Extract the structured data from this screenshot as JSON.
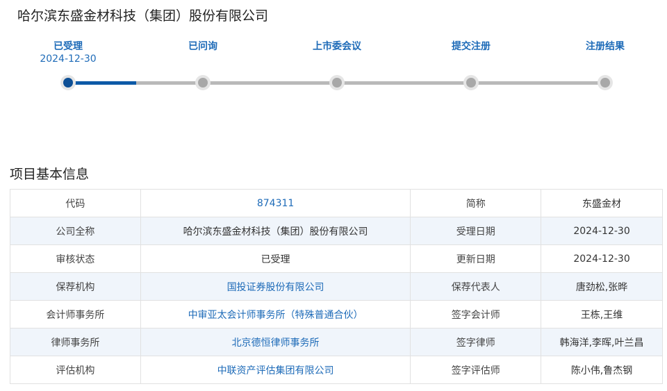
{
  "company": {
    "title": "哈尔滨东盛金材科技（集团）股份有限公司"
  },
  "progress": {
    "steps": [
      {
        "label": "已受理",
        "date": "2024-12-30",
        "active": true
      },
      {
        "label": "已问询",
        "date": "",
        "active": false
      },
      {
        "label": "上市委会议",
        "date": "",
        "active": false
      },
      {
        "label": "提交注册",
        "date": "",
        "active": false
      },
      {
        "label": "注册结果",
        "date": "",
        "active": false
      }
    ],
    "completed_fraction": 0.125
  },
  "section": {
    "title": "项目基本信息"
  },
  "info_table": {
    "rows": [
      {
        "label1": "代码",
        "value1": "874311",
        "label2": "简称",
        "value2": "东盛金材"
      },
      {
        "label1": "公司全称",
        "value1": "哈尔滨东盛金材科技（集团）股份有限公司",
        "label2": "受理日期",
        "value2": "2024-12-30"
      },
      {
        "label1": "审核状态",
        "value1": "已受理",
        "label2": "更新日期",
        "value2": "2024-12-30"
      },
      {
        "label1": "保荐机构",
        "value1": "国投证券股份有限公司",
        "label2": "保荐代表人",
        "value2": "唐劲松,张晔"
      },
      {
        "label1": "会计师事务所",
        "value1": "中审亚太会计师事务所（特殊普通合伙）",
        "label2": "签字会计师",
        "value2": "王栋,王维"
      },
      {
        "label1": "律师事务所",
        "value1": "北京德恒律师事务所",
        "label2": "签字律师",
        "value2": "韩海洋,李晖,叶兰昌"
      },
      {
        "label1": "评估机构",
        "value1": "中联资产评估集团有限公司",
        "label2": "签字评估师",
        "value2": "陈小伟,鲁杰钢"
      }
    ]
  },
  "colors": {
    "accent": "#1e6bb8",
    "track_active": "#0d5aa7",
    "track_inactive": "#b9b9b9",
    "row_alt": "#f0f5fb"
  }
}
